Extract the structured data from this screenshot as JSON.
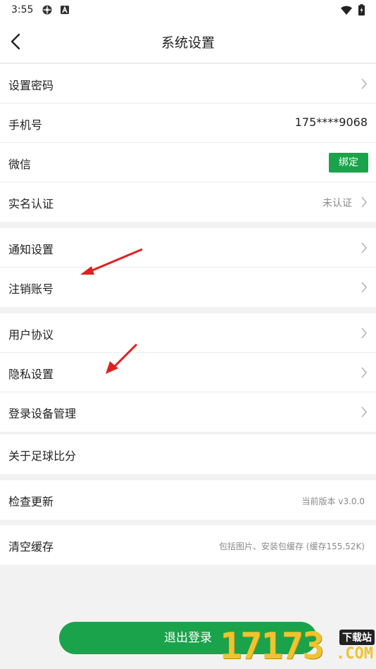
{
  "status_bar": {
    "time": "3:55",
    "icons": [
      "settings-gear-icon",
      "a-badge-icon",
      "wifi-icon",
      "battery-icon"
    ]
  },
  "navbar": {
    "back_icon": "chevron-left-icon",
    "title": "系统设置"
  },
  "groups": [
    {
      "rows": [
        {
          "label": "设置密码",
          "type": "chevron"
        },
        {
          "label": "手机号",
          "value": "175****9068"
        },
        {
          "label": "微信",
          "button": "绑定"
        },
        {
          "label": "实名认证",
          "sub": "未认证",
          "type": "chevron"
        }
      ]
    },
    {
      "rows": [
        {
          "label": "通知设置",
          "type": "chevron"
        },
        {
          "label": "注销账号",
          "type": "chevron"
        }
      ]
    },
    {
      "rows": [
        {
          "label": "用户协议",
          "type": "chevron"
        },
        {
          "label": "隐私设置",
          "type": "chevron"
        },
        {
          "label": "登录设备管理",
          "type": "chevron"
        }
      ]
    },
    {
      "rows": [
        {
          "label": "关于足球比分"
        }
      ]
    },
    {
      "rows": [
        {
          "label": "检查更新",
          "note": "当前版本 v3.0.0"
        }
      ]
    },
    {
      "rows": [
        {
          "label": "清空缓存",
          "note": "包括图片、安装包缓存 (缓存155.52K)"
        }
      ]
    }
  ],
  "logout": {
    "label": "退出登录"
  },
  "watermark": {
    "big": "17173",
    "tag": "下载站",
    "com": ".COM"
  },
  "colors": {
    "accent_green": "#1aa34a",
    "annotation_arrow": "#e02020",
    "background": "#f2f2f2"
  }
}
